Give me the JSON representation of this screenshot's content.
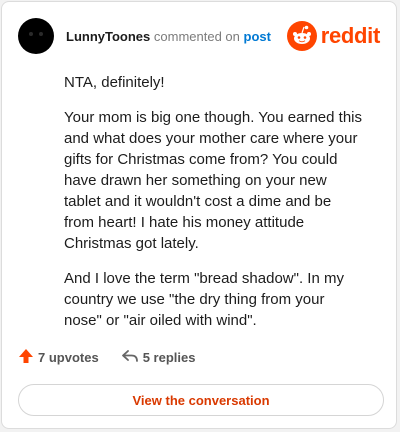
{
  "header": {
    "username": "LunnyToones",
    "action_text": "commented on",
    "post_link": "post",
    "brand": "reddit"
  },
  "comment": {
    "paragraphs": [
      "NTA, definitely!",
      "Your mom is big one though. You earned this and what does your mother care where your gifts for Christmas come from? You could have drawn her something on your new tablet and it wouldn't cost a dime and be from heart! I hate his money attitude Christmas got lately.",
      "And I love the term \"bread shadow\". In my country we use \"the dry thing from your nose\" or \"air oiled with wind\"."
    ]
  },
  "footer": {
    "upvotes": "7 upvotes",
    "replies": "5 replies",
    "view_button": "View the conversation"
  },
  "icons": {
    "upvote": "upvote-arrow-icon",
    "reply": "reply-arrow-icon",
    "logo": "reddit-snoo-icon"
  },
  "colors": {
    "brand": "#ff4500",
    "link": "#0079d3",
    "button_text": "#d93900"
  }
}
